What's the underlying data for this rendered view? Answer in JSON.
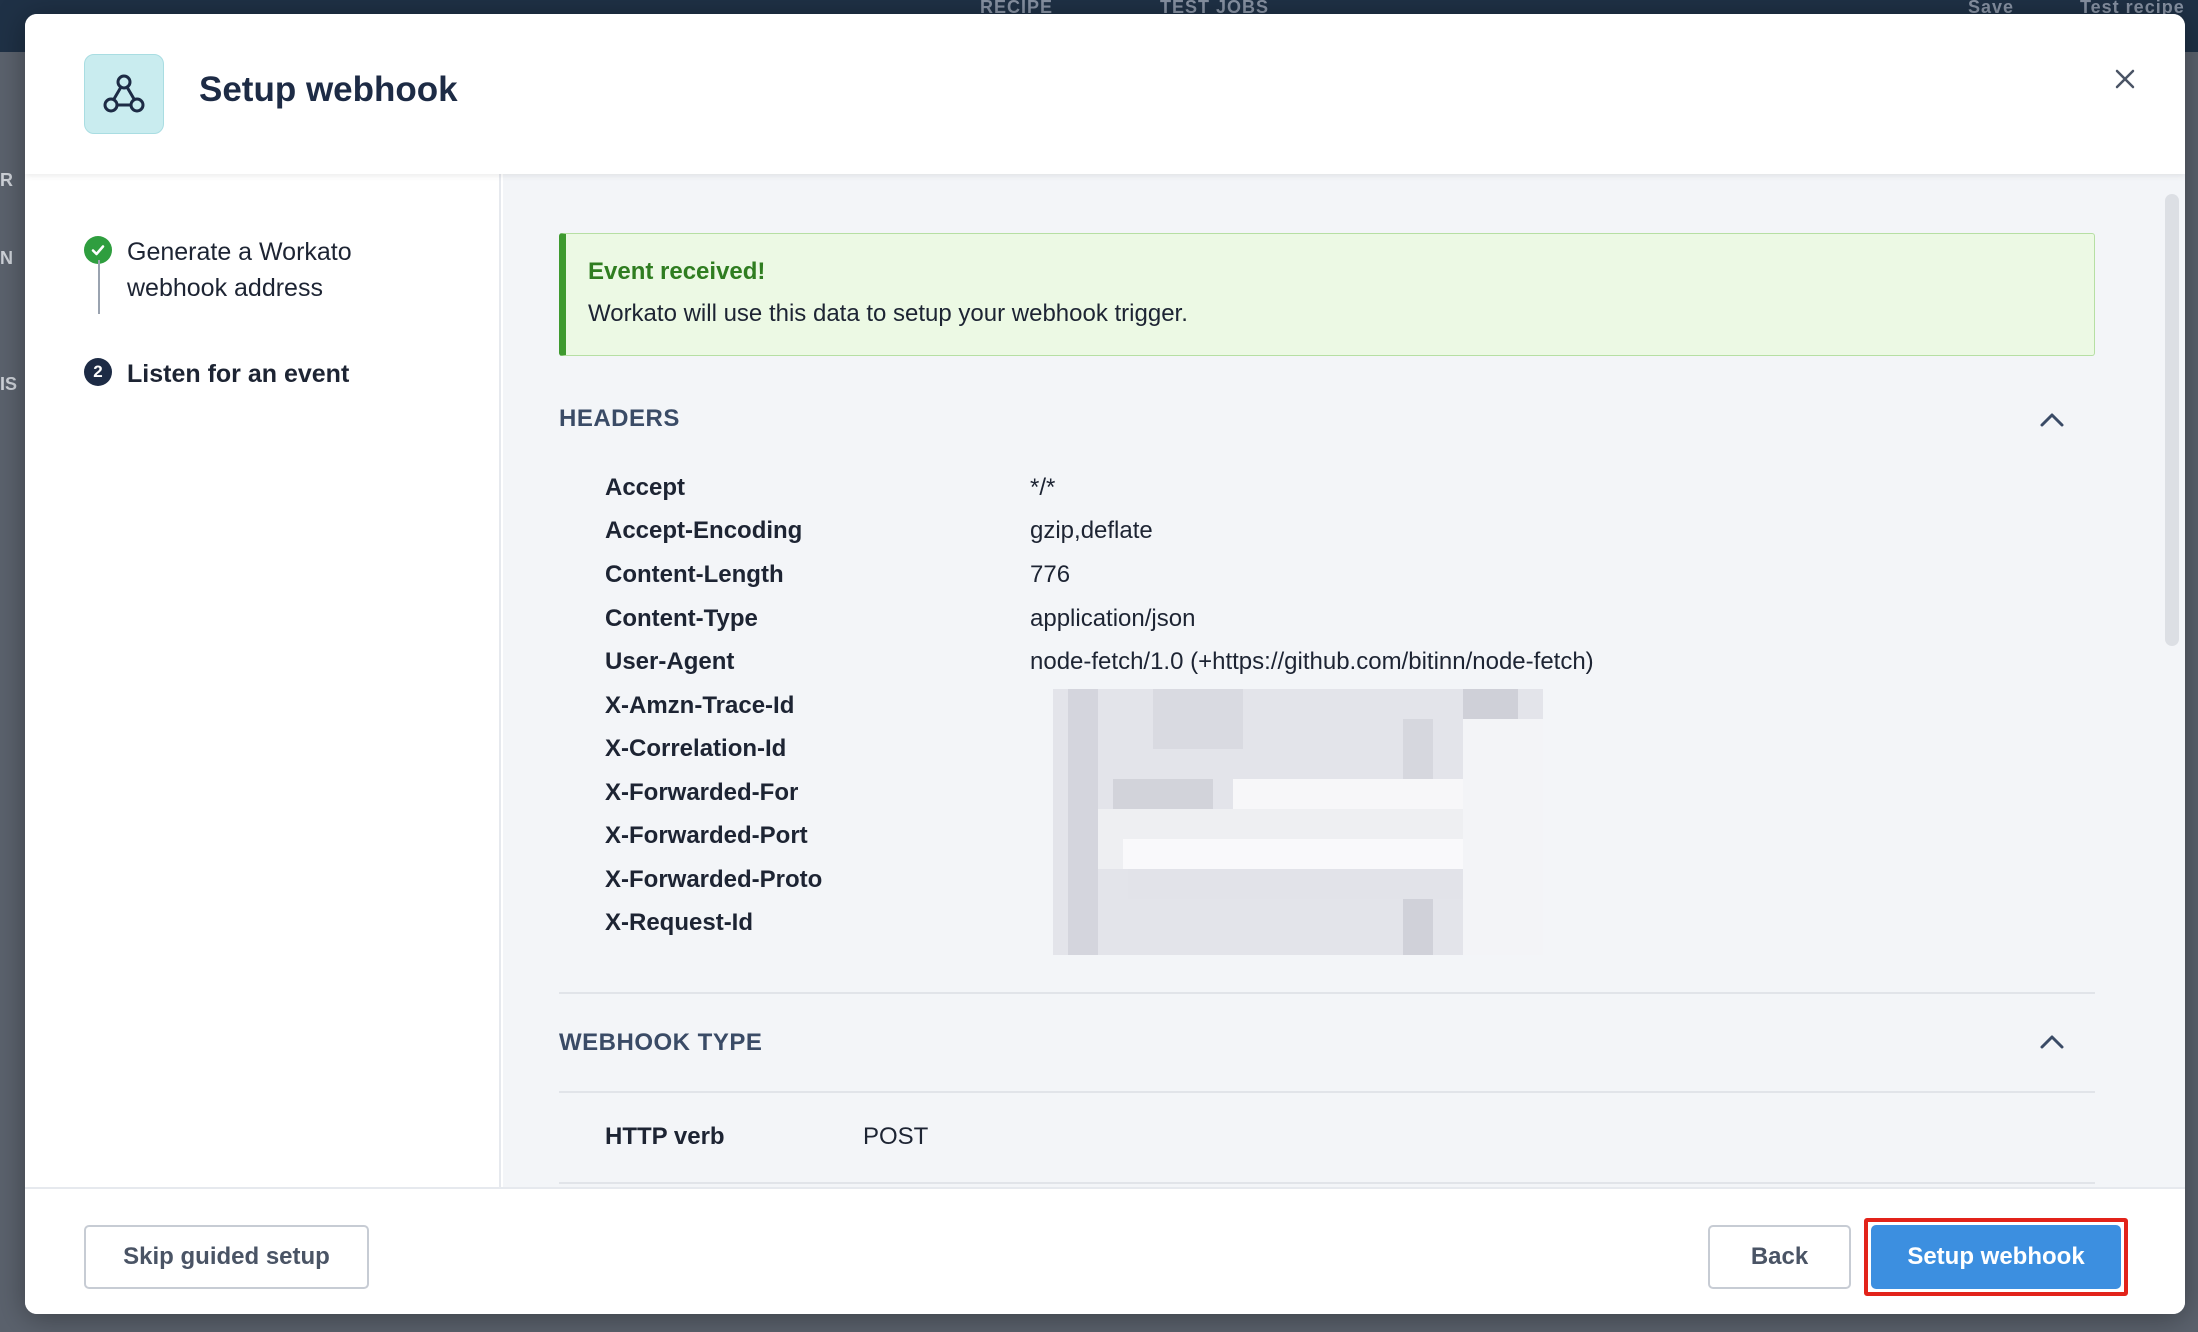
{
  "background": {
    "tabs": [
      "RECIPE",
      "TEST JOBS"
    ],
    "top_right": [
      "Save",
      "Test recipe"
    ],
    "left_letters": [
      "R",
      "N",
      "IS"
    ]
  },
  "modal": {
    "title": "Setup webhook",
    "icon": "webhook-icon",
    "close_icon": "close-icon"
  },
  "steps": [
    {
      "label": "Generate a Workato webhook address",
      "status": "done",
      "icon": "check-icon"
    },
    {
      "number": "2",
      "label": "Listen for an event",
      "status": "active"
    }
  ],
  "alert": {
    "title": "Event received!",
    "text": "Workato will use this data to setup your webhook trigger."
  },
  "headers": {
    "title": "HEADERS",
    "rows": [
      {
        "key": "Accept",
        "value": "*/*"
      },
      {
        "key": "Accept-Encoding",
        "value": "gzip,deflate"
      },
      {
        "key": "Content-Length",
        "value": "776"
      },
      {
        "key": "Content-Type",
        "value": "application/json"
      },
      {
        "key": "User-Agent",
        "value": "node-fetch/1.0 (+https://github.com/bitinn/node-fetch)"
      },
      {
        "key": "X-Amzn-Trace-Id",
        "value": ""
      },
      {
        "key": "X-Correlation-Id",
        "value": ""
      },
      {
        "key": "X-Forwarded-For",
        "value": ""
      },
      {
        "key": "X-Forwarded-Port",
        "value": ""
      },
      {
        "key": "X-Forwarded-Proto",
        "value": ""
      },
      {
        "key": "X-Request-Id",
        "value": ""
      }
    ]
  },
  "webhook_type": {
    "title": "WEBHOOK TYPE",
    "rows": [
      {
        "key": "HTTP verb",
        "value": "POST"
      }
    ]
  },
  "footer": {
    "skip_label": "Skip guided setup",
    "back_label": "Back",
    "setup_label": "Setup webhook"
  },
  "colors": {
    "primary_button": "#3c8fe0",
    "success": "#2f9e3f",
    "highlight_outline": "#e2231a"
  }
}
